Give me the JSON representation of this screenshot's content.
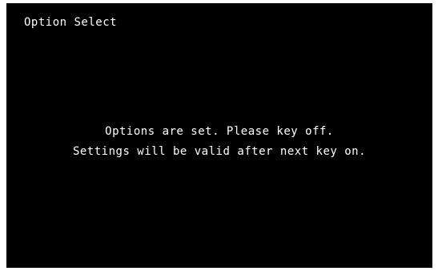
{
  "screen": {
    "title": "Option Select",
    "messages": [
      "Options are set. Please key off.",
      "Settings will be valid after next key on."
    ]
  },
  "colors": {
    "screen_background": "#000000",
    "text": "#ffffff",
    "page_background": "#ffffff"
  }
}
